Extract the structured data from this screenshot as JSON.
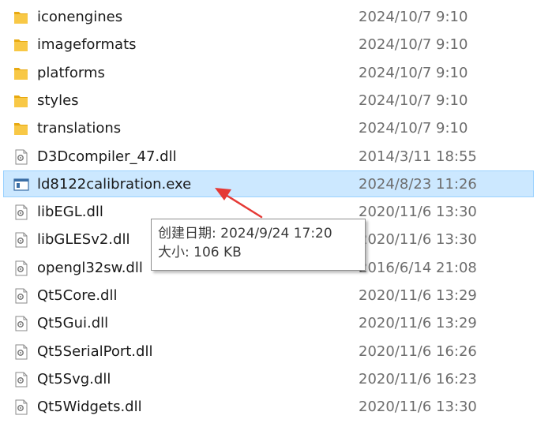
{
  "files": [
    {
      "name": "iconengines",
      "date": "2024/10/7 9:10",
      "type": "folder"
    },
    {
      "name": "imageformats",
      "date": "2024/10/7 9:10",
      "type": "folder"
    },
    {
      "name": "platforms",
      "date": "2024/10/7 9:10",
      "type": "folder"
    },
    {
      "name": "styles",
      "date": "2024/10/7 9:10",
      "type": "folder"
    },
    {
      "name": "translations",
      "date": "2024/10/7 9:10",
      "type": "folder"
    },
    {
      "name": "D3Dcompiler_47.dll",
      "date": "2014/3/11 18:55",
      "type": "dll"
    },
    {
      "name": "ld8122calibration.exe",
      "date": "2024/8/23 11:26",
      "type": "exe",
      "selected": true
    },
    {
      "name": "libEGL.dll",
      "date": "2020/11/6 13:30",
      "type": "dll"
    },
    {
      "name": "libGLESv2.dll",
      "date": "2020/11/6 13:30",
      "type": "dll"
    },
    {
      "name": "opengl32sw.dll",
      "date": "2016/6/14 21:08",
      "type": "dll"
    },
    {
      "name": "Qt5Core.dll",
      "date": "2020/11/6 13:29",
      "type": "dll"
    },
    {
      "name": "Qt5Gui.dll",
      "date": "2020/11/6 13:29",
      "type": "dll"
    },
    {
      "name": "Qt5SerialPort.dll",
      "date": "2020/11/6 16:26",
      "type": "dll"
    },
    {
      "name": "Qt5Svg.dll",
      "date": "2020/11/6 16:23",
      "type": "dll"
    },
    {
      "name": "Qt5Widgets.dll",
      "date": "2020/11/6 13:30",
      "type": "dll"
    }
  ],
  "tooltip": {
    "created": "创建日期: 2024/9/24 17:20",
    "size": "大小: 106 KB"
  },
  "colors": {
    "selection": "#cce8ff",
    "selection_border": "#99d1ff",
    "folder": "#f8c846",
    "arrow": "#e53935"
  },
  "icons": {
    "folder": "folder-icon",
    "dll": "dll-file-icon",
    "exe": "exe-file-icon"
  }
}
